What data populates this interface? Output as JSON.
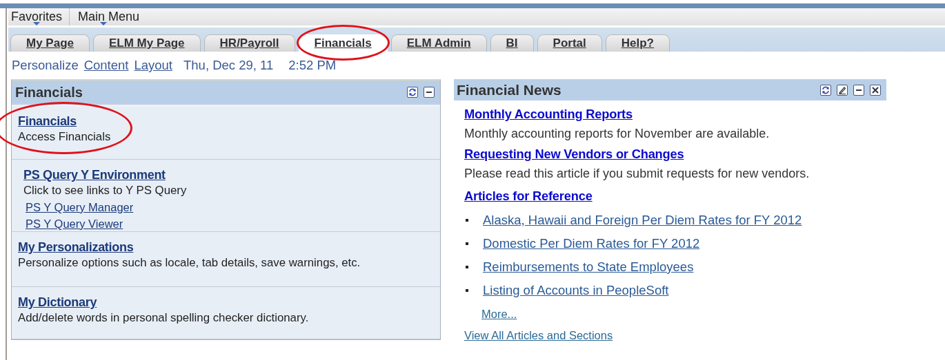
{
  "menu_bar": {
    "items": [
      {
        "label": "Favorites"
      },
      {
        "label": "Main Menu"
      }
    ]
  },
  "tabs": [
    {
      "label": "My Page",
      "selected": false,
      "circled": false
    },
    {
      "label": "ELM My Page",
      "selected": false,
      "circled": false
    },
    {
      "label": "HR/Payroll",
      "selected": false,
      "circled": false
    },
    {
      "label": "Financials",
      "selected": true,
      "circled": true
    },
    {
      "label": "ELM Admin",
      "selected": false,
      "circled": false
    },
    {
      "label": "BI",
      "selected": false,
      "circled": false
    },
    {
      "label": "Portal",
      "selected": false,
      "circled": false
    },
    {
      "label": "Help?",
      "selected": false,
      "circled": false
    }
  ],
  "toolbar": {
    "links": [
      {
        "label": "Personalize",
        "kind": "plain"
      },
      {
        "label": "Content",
        "kind": "underlined"
      },
      {
        "label": "Layout",
        "kind": "underlined"
      }
    ],
    "date": "Thu, Dec 29, 11",
    "time": "2:52 PM"
  },
  "left_panel": {
    "title": "Financials",
    "buttons": [
      {
        "kind": "refresh"
      },
      {
        "kind": "minimize"
      }
    ],
    "items": [
      {
        "title": "Financials",
        "description": "Access Financials",
        "circled": true,
        "indented": false
      },
      {
        "title": "PS Query Y Environment",
        "description": "Click to see links to Y PS Query",
        "links": [
          "PS Y Query Manager",
          "PS Y Query Viewer"
        ],
        "circled": false,
        "indented": true
      },
      {
        "title": "My Personalizations",
        "description": "Personalize options such as locale, tab details, save warnings, etc.",
        "circled": false,
        "indented": false
      },
      {
        "title": "My Dictionary",
        "description": "Add/delete words in personal spelling checker dictionary.",
        "circled": false,
        "indented": false
      }
    ]
  },
  "right_panel": {
    "title": "Financial News",
    "buttons": [
      {
        "kind": "refresh"
      },
      {
        "kind": "edit"
      },
      {
        "kind": "minimize"
      },
      {
        "kind": "close"
      }
    ],
    "articles": [
      {
        "title": "Monthly Accounting Reports",
        "summary": "Monthly accounting reports for November are available."
      },
      {
        "title": "Requesting New Vendors or Changes",
        "summary": "Please read this article if you submit requests for new vendors."
      },
      {
        "title": "Articles for Reference"
      }
    ],
    "bullets": [
      "Alaska, Hawaii and Foreign Per Diem Rates for FY 2012",
      "Domestic Per Diem Rates for FY 2012",
      "Reimbursements to State Employees",
      "Listing of Accounts in PeopleSoft"
    ],
    "more": "More...",
    "view_all": "View All Articles and Sections"
  }
}
